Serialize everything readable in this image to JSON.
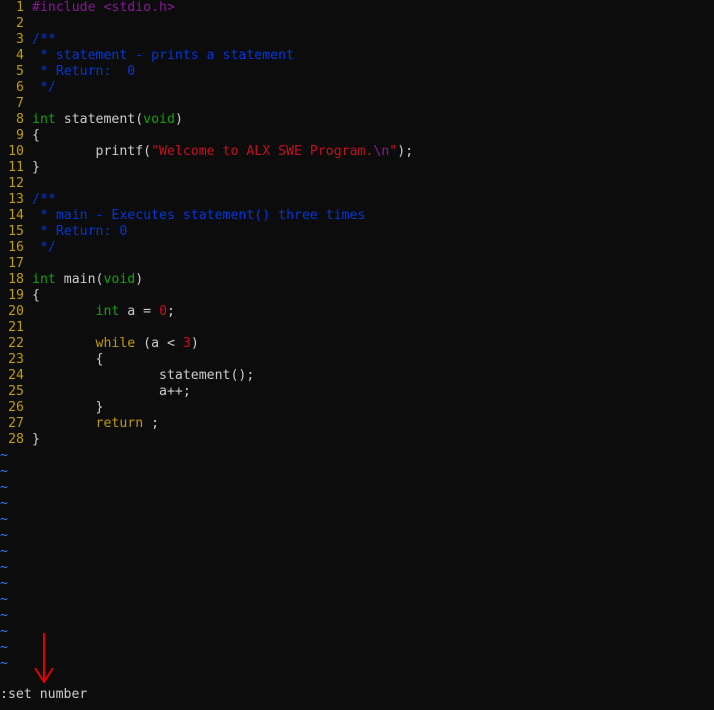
{
  "editor": {
    "lines": [
      {
        "n": "1",
        "tokens": [
          {
            "t": "#include <stdio.h>",
            "c": "pre"
          }
        ]
      },
      {
        "n": "2",
        "tokens": []
      },
      {
        "n": "3",
        "tokens": [
          {
            "t": "/**",
            "c": "com"
          }
        ]
      },
      {
        "n": "4",
        "tokens": [
          {
            "t": " * statement - prints a statement",
            "c": "com"
          }
        ]
      },
      {
        "n": "5",
        "tokens": [
          {
            "t": " * Return:  0",
            "c": "com"
          }
        ]
      },
      {
        "n": "6",
        "tokens": [
          {
            "t": " */",
            "c": "com"
          }
        ]
      },
      {
        "n": "7",
        "tokens": []
      },
      {
        "n": "8",
        "tokens": [
          {
            "t": "int",
            "c": "type"
          },
          {
            "t": " statement(",
            "c": "plain"
          },
          {
            "t": "void",
            "c": "type"
          },
          {
            "t": ")",
            "c": "plain"
          }
        ]
      },
      {
        "n": "9",
        "tokens": [
          {
            "t": "{",
            "c": "plain"
          }
        ]
      },
      {
        "n": "10",
        "tokens": [
          {
            "t": "        printf(",
            "c": "plain"
          },
          {
            "t": "\"Welcome to ALX SWE Program.",
            "c": "str"
          },
          {
            "t": "\\n",
            "c": "pre"
          },
          {
            "t": "\"",
            "c": "str"
          },
          {
            "t": ");",
            "c": "plain"
          }
        ]
      },
      {
        "n": "11",
        "tokens": [
          {
            "t": "}",
            "c": "plain"
          }
        ]
      },
      {
        "n": "12",
        "tokens": []
      },
      {
        "n": "13",
        "tokens": [
          {
            "t": "/**",
            "c": "com"
          }
        ]
      },
      {
        "n": "14",
        "tokens": [
          {
            "t": " * main - Executes statement() three times",
            "c": "com"
          }
        ]
      },
      {
        "n": "15",
        "tokens": [
          {
            "t": " * Return: 0",
            "c": "com"
          }
        ]
      },
      {
        "n": "16",
        "tokens": [
          {
            "t": " */",
            "c": "com"
          }
        ]
      },
      {
        "n": "17",
        "tokens": []
      },
      {
        "n": "18",
        "tokens": [
          {
            "t": "int",
            "c": "type"
          },
          {
            "t": " main(",
            "c": "plain"
          },
          {
            "t": "void",
            "c": "type"
          },
          {
            "t": ")",
            "c": "plain"
          }
        ]
      },
      {
        "n": "19",
        "tokens": [
          {
            "t": "{",
            "c": "plain"
          }
        ]
      },
      {
        "n": "20",
        "tokens": [
          {
            "t": "        ",
            "c": "plain"
          },
          {
            "t": "int",
            "c": "type"
          },
          {
            "t": " a = ",
            "c": "plain"
          },
          {
            "t": "0",
            "c": "num"
          },
          {
            "t": ";",
            "c": "plain"
          }
        ]
      },
      {
        "n": "21",
        "tokens": []
      },
      {
        "n": "22",
        "tokens": [
          {
            "t": "        ",
            "c": "plain"
          },
          {
            "t": "while",
            "c": "kw"
          },
          {
            "t": " (a < ",
            "c": "plain"
          },
          {
            "t": "3",
            "c": "num"
          },
          {
            "t": ")",
            "c": "plain"
          }
        ]
      },
      {
        "n": "23",
        "tokens": [
          {
            "t": "        {",
            "c": "plain"
          }
        ]
      },
      {
        "n": "24",
        "tokens": [
          {
            "t": "                statement();",
            "c": "plain"
          }
        ]
      },
      {
        "n": "25",
        "tokens": [
          {
            "t": "                a++;",
            "c": "plain"
          }
        ]
      },
      {
        "n": "26",
        "tokens": [
          {
            "t": "        }",
            "c": "plain"
          }
        ]
      },
      {
        "n": "27",
        "tokens": [
          {
            "t": "        ",
            "c": "plain"
          },
          {
            "t": "return",
            "c": "kw"
          },
          {
            "t": " ;",
            "c": "plain"
          }
        ]
      },
      {
        "n": "28",
        "tokens": [
          {
            "t": "}",
            "c": "plain"
          }
        ]
      }
    ],
    "tilde": "~",
    "tilde_count": 14
  },
  "cmdline": {
    "text": ":set number"
  },
  "annotation": {
    "icon": "down-arrow-icon",
    "color": "#e00000"
  }
}
